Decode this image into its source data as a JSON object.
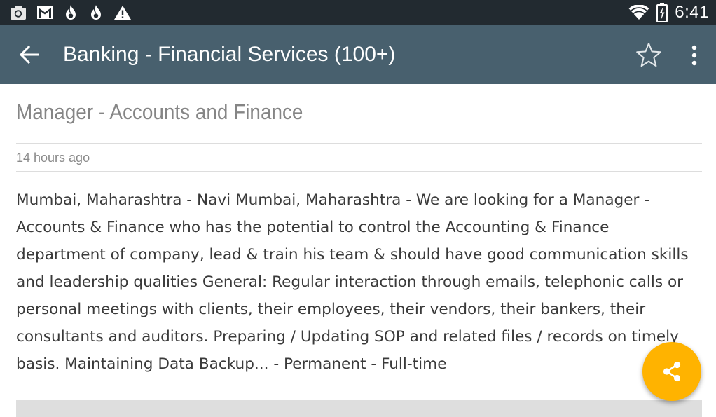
{
  "status_bar": {
    "time": "6:41",
    "left_icons": [
      "camera-icon",
      "gmail-icon",
      "flame-icon",
      "flame-icon",
      "warning-icon"
    ],
    "right_icons": [
      "wifi-icon",
      "battery-charging-icon"
    ]
  },
  "app_bar": {
    "title": "Banking - Financial Services (100+)",
    "background": "#48606e",
    "actions": [
      "back-arrow-icon",
      "star-outline-icon",
      "more-vert-icon"
    ]
  },
  "job": {
    "title": "Manager - Accounts and Finance",
    "posted": "14 hours ago",
    "description": "Mumbai, Maharashtra - Navi Mumbai, Maharashtra - We are looking for a Manager - Accounts & Finance who has the potential to control the Accounting & Finance department of company, lead & train his team & should have good communication skills and leadership qualities General: Regular interaction through emails, telephonic calls or personal meetings with clients, their employees, their vendors, their bankers, their consultants and auditors. Preparing / Updating SOP and related files / records on timely basis. Maintaining Data Backup... - Permanent - Full-time"
  },
  "fab": {
    "icon": "share-icon",
    "color": "#ffb300"
  }
}
